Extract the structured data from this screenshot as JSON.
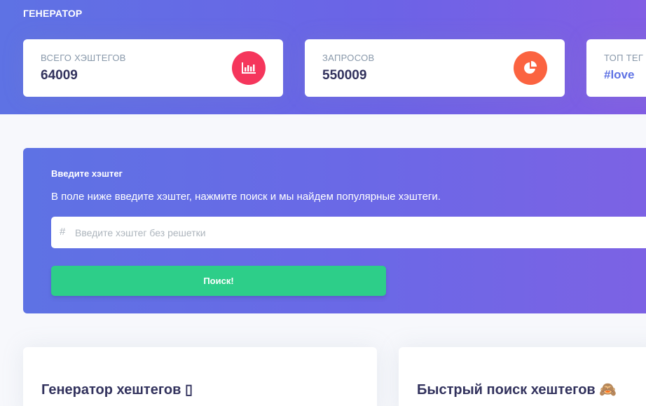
{
  "header": {
    "brand": "ГЕНЕРАТОР"
  },
  "stats": [
    {
      "label": "ВСЕГО ХЭШТЕГОВ",
      "value": "64009",
      "icon": "bar-chart-icon",
      "color": "#f5365c"
    },
    {
      "label": "ЗАПРОСОВ",
      "value": "550009",
      "icon": "pie-chart-icon",
      "color": "#fb6340"
    },
    {
      "label": "ТОП ТЕГ",
      "value": "#love"
    }
  ],
  "search": {
    "title": "Введите хэштег",
    "description": "В поле ниже введите хэштег, нажмите поиск и мы найдем популярные хэштеги.",
    "prefix": "#",
    "placeholder": "Введите хэштег без решетки",
    "button_label": "Поиск!",
    "button_color": "#2dce89"
  },
  "sections": [
    {
      "title": "Генератор хештегов ▯"
    },
    {
      "title": "Быстрый поиск хештегов 🙈"
    }
  ]
}
